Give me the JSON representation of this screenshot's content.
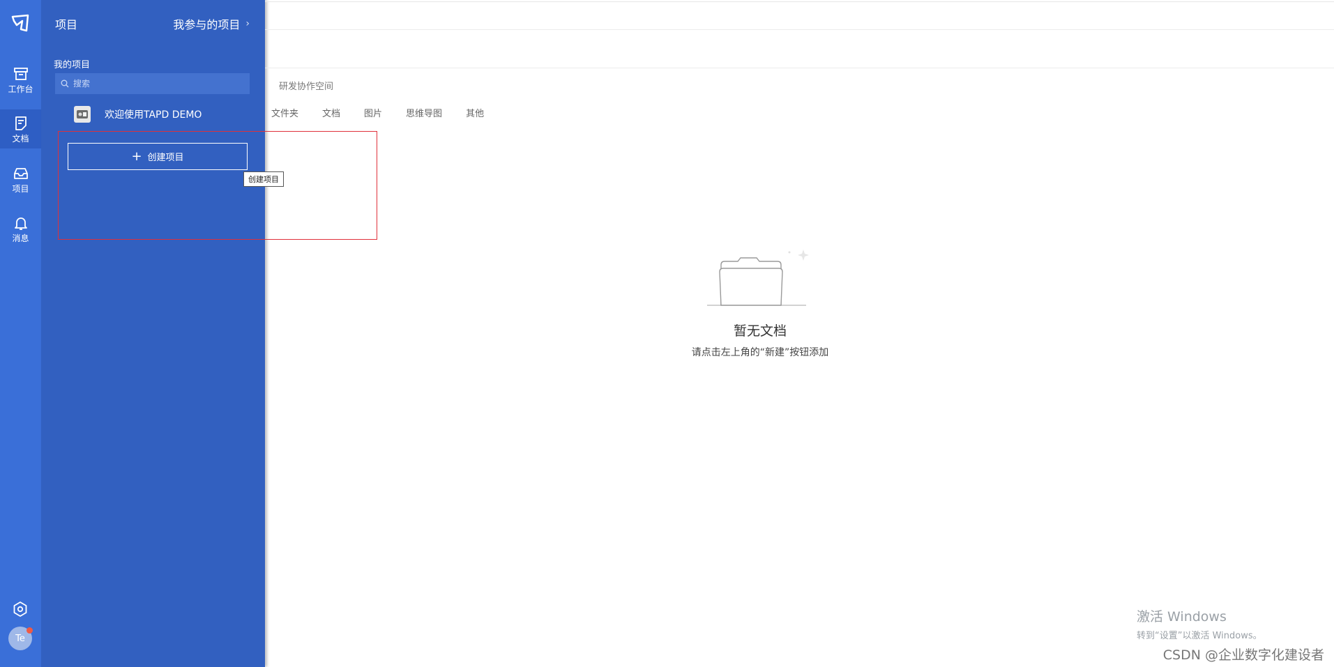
{
  "rail": {
    "items": [
      {
        "label": "工作台"
      },
      {
        "label": "文档"
      },
      {
        "label": "项目"
      },
      {
        "label": "消息"
      }
    ],
    "avatar_text": "Te"
  },
  "drawer": {
    "title": "项目",
    "participated_link": "我参与的项目",
    "section_label": "我的项目",
    "search_placeholder": "搜索",
    "projects": [
      {
        "name": "欢迎使用TAPD DEMO"
      }
    ],
    "create_button": "创建项目"
  },
  "tooltip": "创建项目",
  "content": {
    "breadcrumb": "研发协作空间",
    "tabs": [
      "文件夹",
      "文档",
      "图片",
      "思维导图",
      "其他"
    ],
    "empty_title": "暂无文档",
    "empty_hint": "请点击左上角的“新建”按钮添加"
  },
  "watermark": {
    "line1": "激活 Windows",
    "line2": "转到“设置”以激活 Windows。",
    "csdn": "CSDN @企业数字化建设者"
  },
  "colors": {
    "rail_bg": "#3a6fd8",
    "drawer_bg": "#3260c0",
    "highlight": "#e0303a"
  }
}
